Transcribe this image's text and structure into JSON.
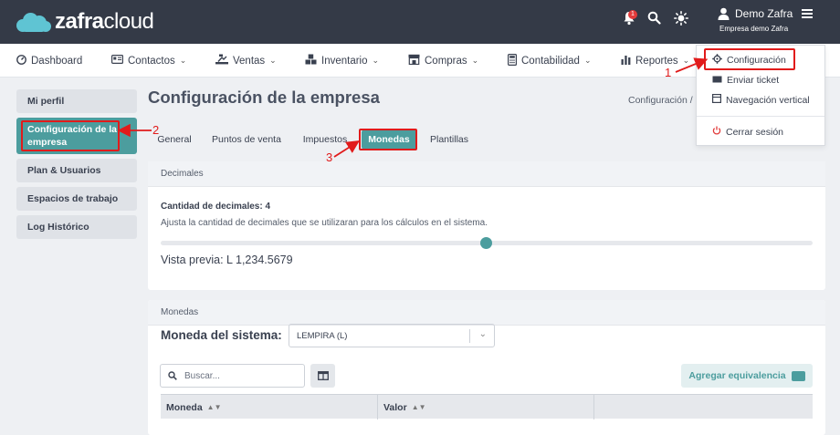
{
  "app": {
    "brand": "zafra",
    "brand_suffix": "cloud",
    "notification_count": "1",
    "user_name": "Demo Zafra",
    "company": "Empresa demo Zafra"
  },
  "nav": [
    {
      "label": "Dashboard",
      "icon": "dashboard-icon"
    },
    {
      "label": "Contactos",
      "icon": "contacts-icon"
    },
    {
      "label": "Ventas",
      "icon": "sales-icon"
    },
    {
      "label": "Inventario",
      "icon": "inventory-icon"
    },
    {
      "label": "Compras",
      "icon": "purchases-icon"
    },
    {
      "label": "Contabilidad",
      "icon": "accounting-icon"
    },
    {
      "label": "Reportes",
      "icon": "reports-icon"
    }
  ],
  "sidebar": {
    "items": [
      {
        "label": "Mi perfil",
        "active": false
      },
      {
        "label": "Configuración de la empresa",
        "active": true
      },
      {
        "label": "Plan & Usuarios",
        "active": false
      },
      {
        "label": "Espacios de trabajo",
        "active": false
      },
      {
        "label": "Log Histórico",
        "active": false
      }
    ]
  },
  "page": {
    "title": "Configuración de la empresa",
    "breadcrumb": "Configuración /"
  },
  "tabs": [
    {
      "label": "General",
      "active": false
    },
    {
      "label": "Puntos de venta",
      "active": false
    },
    {
      "label": "Impuestos",
      "active": false
    },
    {
      "label": "Monedas",
      "active": true
    },
    {
      "label": "Plantillas",
      "active": false
    }
  ],
  "decimals": {
    "section_title": "Decimales",
    "quantity_label": "Cantidad de decimales: 4",
    "description": "Ajusta la cantidad de decimales que se utilizaran para los cálculos en el sistema.",
    "slider_value": 4,
    "slider_max": 8,
    "preview": "Vista previa: L 1,234.5679"
  },
  "currencies": {
    "section_title": "Monedas",
    "system_currency_label": "Moneda del sistema:",
    "system_currency_value": "LEMPIRA (L)",
    "search_placeholder": "Buscar...",
    "add_button": "Agregar equivalencia",
    "columns": [
      "Moneda",
      "Valor",
      ""
    ]
  },
  "user_menu": [
    {
      "label": "Configuración",
      "icon": "gear-icon"
    },
    {
      "label": "Enviar ticket",
      "icon": "ticket-icon"
    },
    {
      "label": "Navegación vertical",
      "icon": "layout-icon"
    },
    {
      "label": "Cerrar sesión",
      "icon": "power-icon"
    }
  ],
  "annotations": {
    "n1": "1",
    "n2": "2",
    "n3": "3",
    "color": "#e11b1b"
  },
  "colors": {
    "topbar": "#343a47",
    "accent": "#4c9d9e",
    "logo_cloud": "#5fc4d3"
  }
}
